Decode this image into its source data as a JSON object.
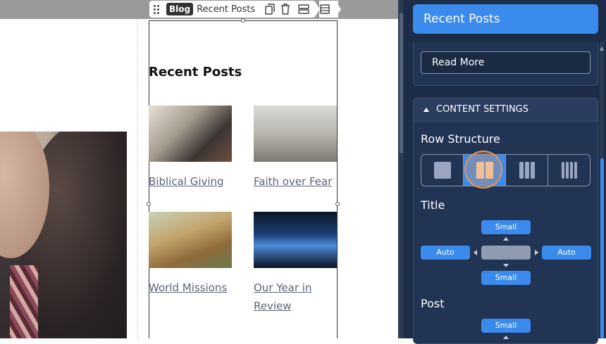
{
  "toolbar": {
    "badge": "Blog",
    "label": "Recent Posts"
  },
  "content": {
    "section_title": "Recent Posts",
    "posts": [
      {
        "title": "Biblical Giving"
      },
      {
        "title": "Faith over Fear"
      },
      {
        "title": "World Missions"
      },
      {
        "title_line1": "Our Year in",
        "title_line2": "Review"
      }
    ]
  },
  "panel": {
    "header": "Recent Posts",
    "read_more_value": "Read More",
    "content_settings_label": "CONTENT SETTINGS",
    "row_structure_label": "Row Structure",
    "row_structure_selected": "2 columns",
    "title_label": "Title",
    "title_spacing": {
      "top": "Small",
      "bottom": "Small",
      "left": "Auto",
      "right": "Auto"
    },
    "post_label": "Post",
    "post_spacing": {
      "top": "Small"
    }
  },
  "colors": {
    "panel_bg": "#1d2d47",
    "accent": "#3b8bec",
    "link": "#5b6475"
  }
}
